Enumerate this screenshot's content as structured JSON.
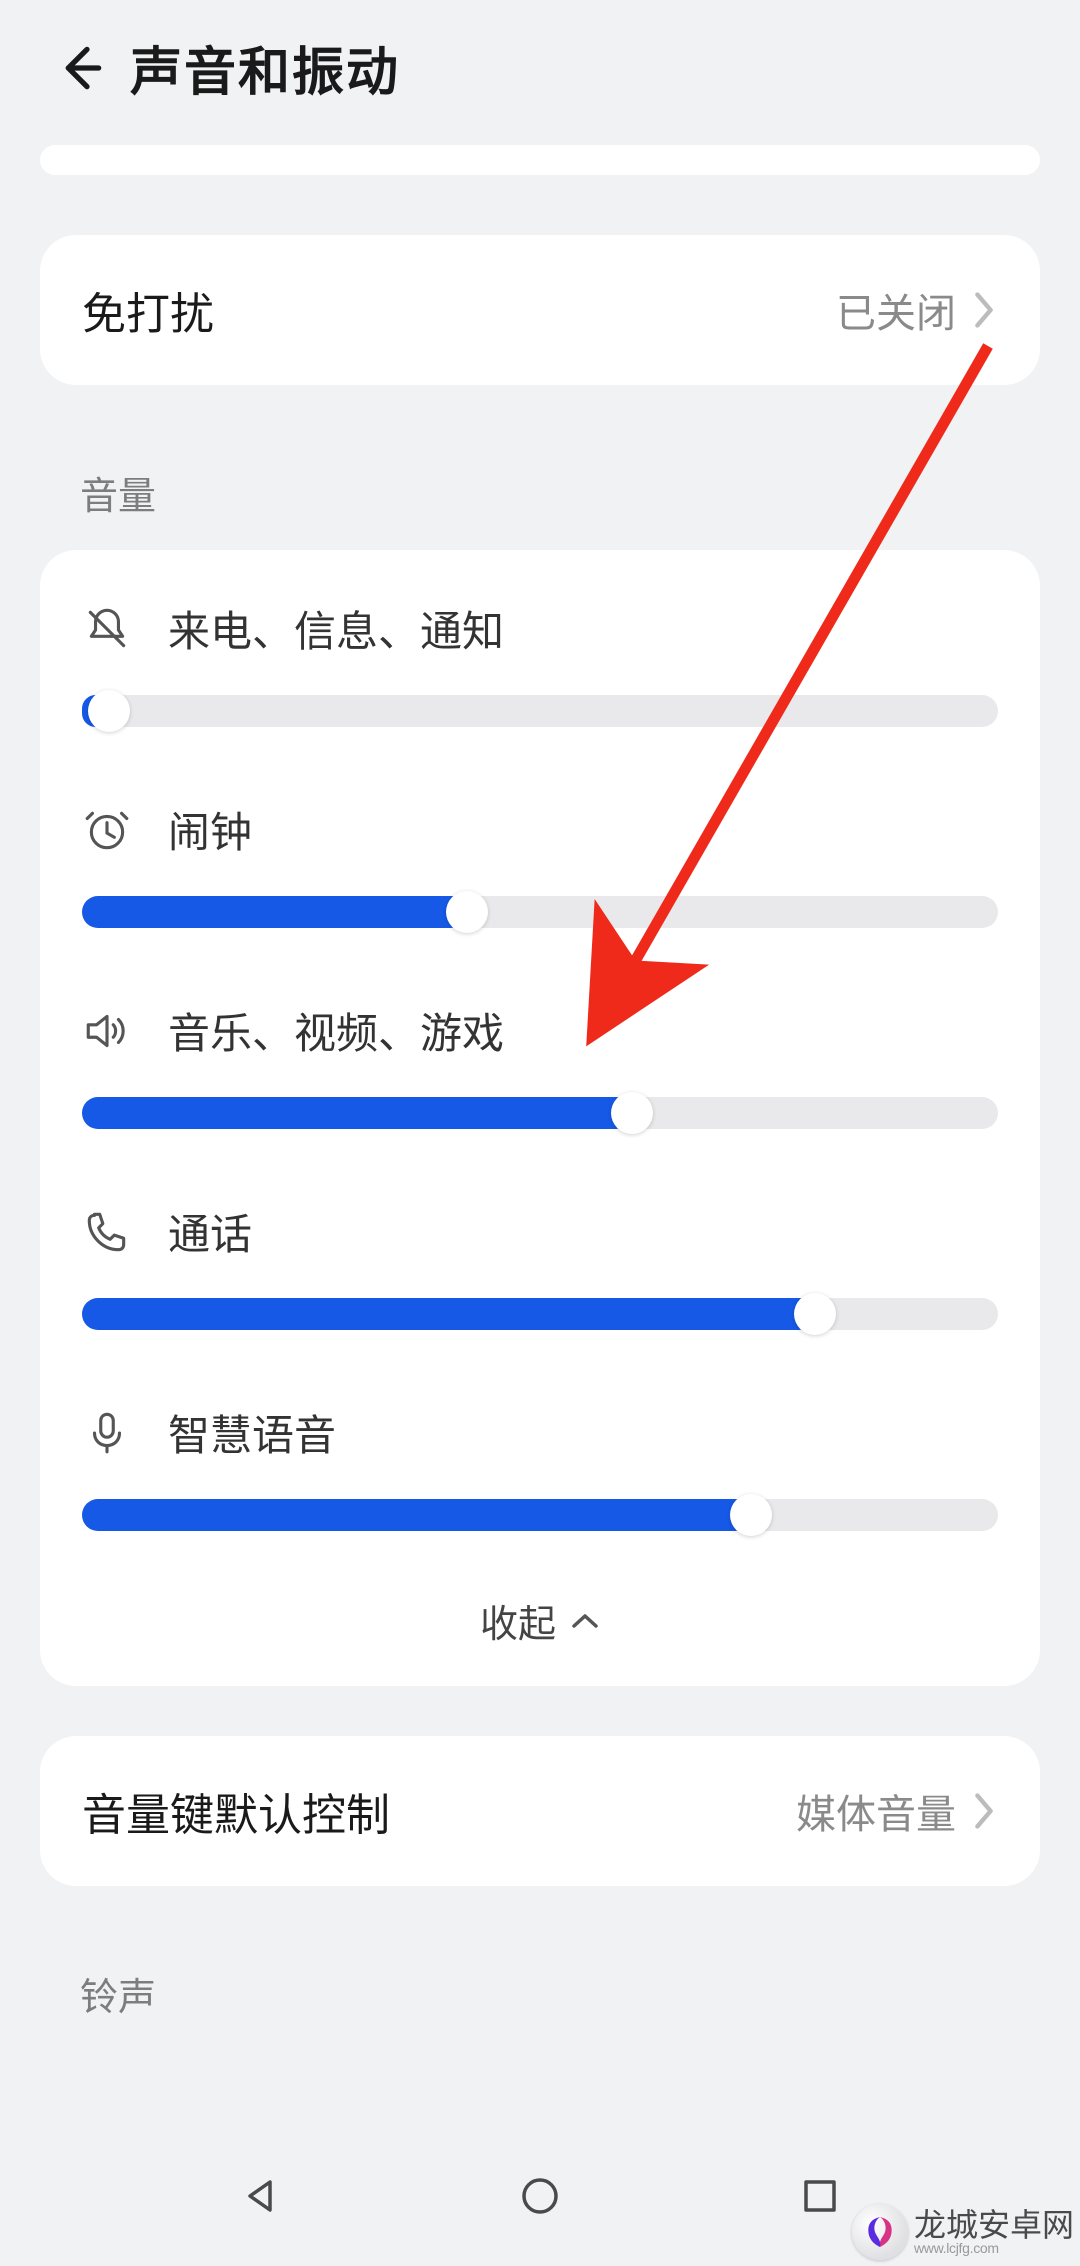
{
  "header": {
    "title": "声音和振动"
  },
  "dnd": {
    "label": "免打扰",
    "value": "已关闭"
  },
  "sections": {
    "volume": "音量",
    "ringtone": "铃声"
  },
  "sliders": {
    "ring": {
      "label": "来电、信息、通知",
      "percent": 3,
      "icon": "bell-off"
    },
    "alarm": {
      "label": "闹钟",
      "percent": 42,
      "icon": "alarm"
    },
    "media": {
      "label": "音乐、视频、游戏",
      "percent": 60,
      "icon": "speaker"
    },
    "call": {
      "label": "通话",
      "percent": 80,
      "icon": "phone"
    },
    "voice": {
      "label": "智慧语音",
      "percent": 73,
      "icon": "mic"
    }
  },
  "collapse": "收起",
  "volumeKey": {
    "label": "音量键默认控制",
    "value": "媒体音量"
  },
  "colors": {
    "accent": "#1659e6",
    "arrow": "#ef2a1a"
  },
  "watermark": {
    "text": "龙城安卓网",
    "sub": "www.lcjfg.com"
  }
}
